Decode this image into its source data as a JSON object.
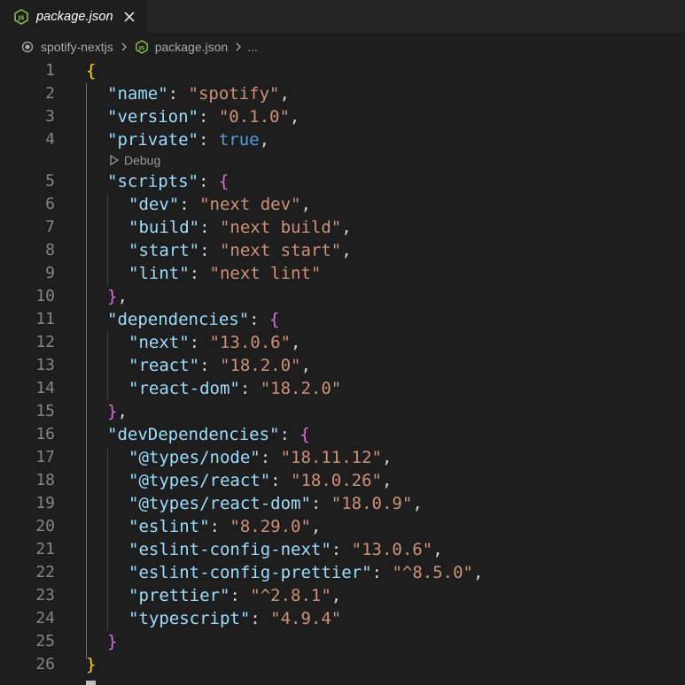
{
  "tab": {
    "label": "package.json",
    "icon": "nodejs-icon",
    "close_glyph": "✕"
  },
  "breadcrumb": {
    "folder": "spotify-nextjs",
    "file": "package.json",
    "more": "..."
  },
  "codelens": {
    "label": "Debug"
  },
  "colors": {
    "key": "#9cdcfe",
    "string": "#ce9178",
    "boolean": "#569cd6",
    "brace_level1": "#ffd700",
    "brace_level2": "#da70d6",
    "line_number": "#858585",
    "background": "#1e1e1e"
  },
  "lines": [
    {
      "n": "1"
    },
    {
      "n": "2",
      "k": "\"name\"",
      "v": "\"spotify\""
    },
    {
      "n": "3",
      "k": "\"version\"",
      "v": "\"0.1.0\""
    },
    {
      "n": "4",
      "k": "\"private\"",
      "v": "true"
    },
    {
      "n": "5",
      "k": "\"scripts\""
    },
    {
      "n": "6",
      "k": "\"dev\"",
      "v": "\"next dev\""
    },
    {
      "n": "7",
      "k": "\"build\"",
      "v": "\"next build\""
    },
    {
      "n": "8",
      "k": "\"start\"",
      "v": "\"next start\""
    },
    {
      "n": "9",
      "k": "\"lint\"",
      "v": "\"next lint\""
    },
    {
      "n": "10"
    },
    {
      "n": "11",
      "k": "\"dependencies\""
    },
    {
      "n": "12",
      "k": "\"next\"",
      "v": "\"13.0.6\""
    },
    {
      "n": "13",
      "k": "\"react\"",
      "v": "\"18.2.0\""
    },
    {
      "n": "14",
      "k": "\"react-dom\"",
      "v": "\"18.2.0\""
    },
    {
      "n": "15"
    },
    {
      "n": "16",
      "k": "\"devDependencies\""
    },
    {
      "n": "17",
      "k": "\"@types/node\"",
      "v": "\"18.11.12\""
    },
    {
      "n": "18",
      "k": "\"@types/react\"",
      "v": "\"18.0.26\""
    },
    {
      "n": "19",
      "k": "\"@types/react-dom\"",
      "v": "\"18.0.9\""
    },
    {
      "n": "20",
      "k": "\"eslint\"",
      "v": "\"8.29.0\""
    },
    {
      "n": "21",
      "k": "\"eslint-config-next\"",
      "v": "\"13.0.6\""
    },
    {
      "n": "22",
      "k": "\"eslint-config-prettier\"",
      "v": "\"^8.5.0\""
    },
    {
      "n": "23",
      "k": "\"prettier\"",
      "v": "\"^2.8.1\""
    },
    {
      "n": "24",
      "k": "\"typescript\"",
      "v": "\"4.9.4\""
    },
    {
      "n": "25"
    },
    {
      "n": "26"
    }
  ]
}
